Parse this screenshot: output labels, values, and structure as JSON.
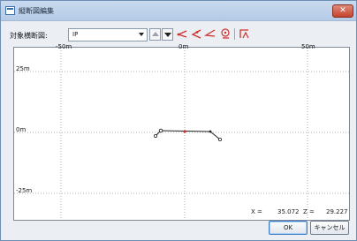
{
  "window": {
    "title": "縦断図編集",
    "close_label": "✕"
  },
  "toolbar": {
    "target_label": "対象横断図:",
    "target_value": "IP",
    "up_icon": "triangle-up-icon",
    "down_icon": "triangle-down-icon",
    "tool_icons": [
      "add-vertex-icon",
      "move-vertex-icon",
      "delete-vertex-icon",
      "zoom-fit-icon",
      "measure-icon"
    ],
    "accent_color": "#d0302c"
  },
  "plot": {
    "x_labels": [
      "-50m",
      "0m",
      "50m"
    ],
    "y_labels": [
      "25m",
      "0m",
      "-25m"
    ],
    "x_readout_label": "X =",
    "x_readout_value": "35.072",
    "z_readout_label": "Z =",
    "z_readout_value": "29.227",
    "grid": "dotted",
    "line_color": "#222222",
    "selected_color": "#d0302c"
  },
  "buttons": {
    "ok_label": "OK",
    "cancel_label": "キャンセル"
  }
}
